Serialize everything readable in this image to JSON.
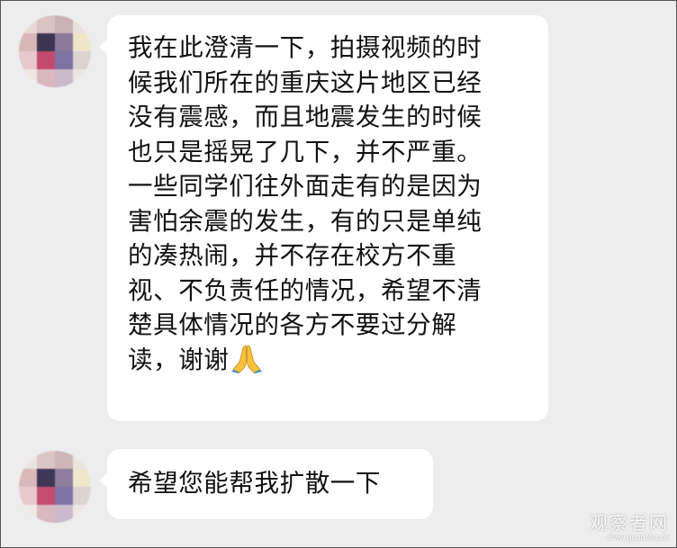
{
  "messages": [
    {
      "lines": [
        "我在此澄清一下，拍摄视频的时",
        "候我们所在的重庆这片地区已经",
        "没有震感，而且地震发生的时候",
        "也只是摇晃了几下，并不严重。",
        "一些同学们往外面走有的是因为",
        "害怕余震的发生，有的只是单纯",
        "的凑热闹，并不存在校方不重",
        "视、不负责任的情况，希望不清",
        "楚具体情况的各方不要过分解",
        "读，谢谢"
      ],
      "emoji": "folded-hands-icon"
    },
    {
      "text": "希望您能帮我扩散一下"
    }
  ],
  "watermark": {
    "name": "观察者网",
    "url": "www.guancha.cn"
  },
  "colors": {
    "background": "#ededed",
    "bubble": "#ffffff",
    "text": "#111111"
  }
}
